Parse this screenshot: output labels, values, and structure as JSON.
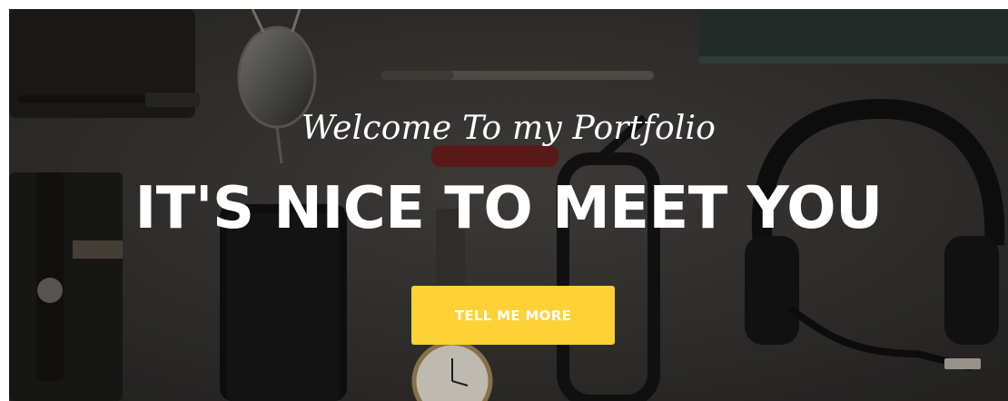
{
  "hero": {
    "subheading": "Welcome To my Portfolio",
    "heading": "IT'S NICE TO MEET YOU",
    "cta_label": "TELL ME MORE",
    "background_image": "desk-flatlay-accessories"
  },
  "colors": {
    "accent": "#fed136",
    "text": "#ffffff",
    "background": "#34322f"
  }
}
